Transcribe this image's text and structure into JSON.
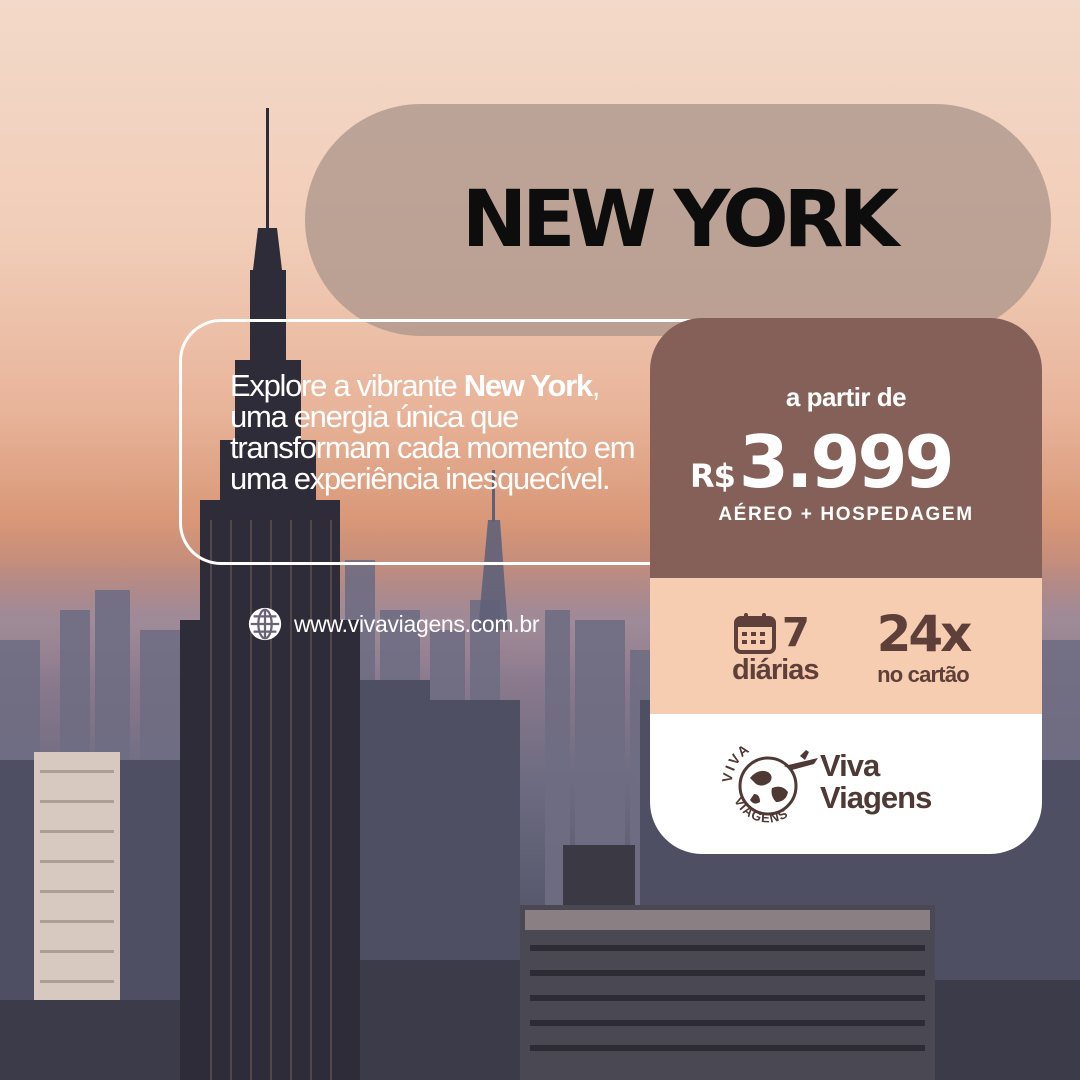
{
  "headline": {
    "title": "NEW YORK"
  },
  "description": {
    "part1": "Explore a vibrante ",
    "highlight": "New York",
    "part2": ", uma energia única que transformam cada momento em uma experiência inesquecível."
  },
  "website": {
    "url": "www.vivaviagens.com.br",
    "icon": "globe-icon"
  },
  "offer": {
    "from_label": "a partir de",
    "currency": "R$",
    "price": "3.999",
    "package": "AÉREO + HOSPEDAGEM",
    "nights_number": "7",
    "nights_label": "diárias",
    "nights_icon": "calendar-icon",
    "installments": "24x",
    "installments_label": "no cartão"
  },
  "brand": {
    "name_line1": "Viva",
    "name_line2": "Viagens",
    "logo_top": "VIVA",
    "logo_bottom": "VIAGENS",
    "logo_icon": "globe-airplane-logo"
  },
  "colors": {
    "card_top": "#856059",
    "card_mid": "#f6cdb0",
    "card_bottom": "#ffffff",
    "title_pill": "#b0988e",
    "accent_text": "#5e3f39"
  }
}
